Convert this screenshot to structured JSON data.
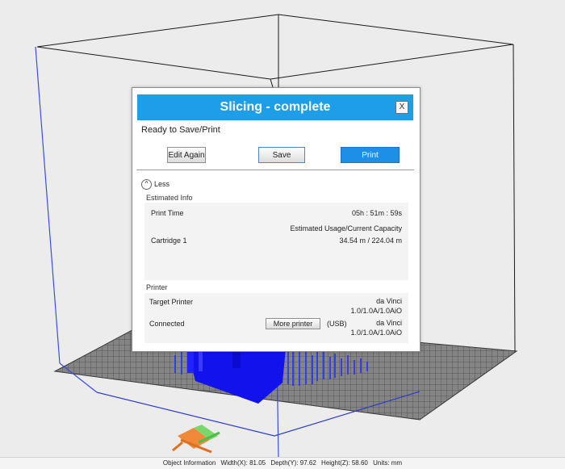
{
  "dialog": {
    "title": "Slicing - complete",
    "close_label": "X",
    "status": "Ready to Save/Print",
    "buttons": {
      "edit_again": "Edit Again",
      "save": "Save",
      "print": "Print"
    },
    "less_label": "Less",
    "estimated": {
      "heading": "Estimated Info",
      "print_time_label": "Print Time",
      "print_time_value": "05h : 51m : 59s",
      "usage_heading": "Estimated Usage/Current Capacity",
      "cartridge_label": "Cartridge 1",
      "cartridge_value": "34.54 m / 224.04 m"
    },
    "printer": {
      "heading": "Printer",
      "target_label": "Target Printer",
      "target_value_line1": "da Vinci",
      "target_value_line2": "1.0/1.0A/1.0AiO",
      "connected_label": "Connected",
      "more_printer_label": "More printer",
      "usb_label": "(USB)",
      "connected_value_line1": "da Vinci",
      "connected_value_line2": "1.0/1.0A/1.0AiO"
    }
  },
  "statusbar": {
    "object_info": "Object Information",
    "width": "Width(X): 81.05",
    "depth": "Depth(Y): 97.62",
    "height": "Height(Z): 58.60",
    "units": "Units: mm"
  },
  "colors": {
    "title_bar": "#1e9ee6",
    "print_button": "#1e8fe6",
    "model": "#1010ee",
    "build_plate": "#7a7a7a",
    "frame_blue": "#3b4de0"
  },
  "icons": {
    "less_toggle": "chevron-up-icon",
    "axis": "xyz-axis-arrows-icon"
  }
}
